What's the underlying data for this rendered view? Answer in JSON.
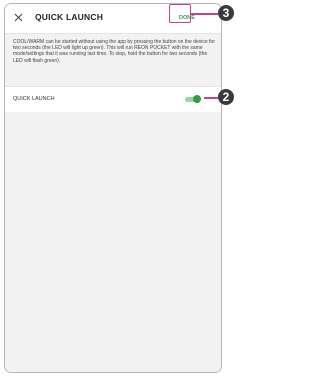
{
  "header": {
    "title": "QUICK LAUNCH",
    "done_label": "DONE",
    "close_icon": "close-icon"
  },
  "description": "COOL/WARM can be started without using the app by pressing the button on the device for two seconds (the LED will light up green). This will run REON POCKET with the same mode/settings that it was running last time. To stop, hold the button for two seconds (the LED will flash green).",
  "setting": {
    "label": "QUICK LAUNCH",
    "toggle_state": "on"
  },
  "callouts": [
    {
      "number": "3",
      "target": "done-button"
    },
    {
      "number": "2",
      "target": "quick-launch-toggle"
    }
  ],
  "colors": {
    "accent_green": "#2e9e44",
    "callout_magenta": "#c2458c",
    "badge_dark": "#3a3a3a"
  }
}
